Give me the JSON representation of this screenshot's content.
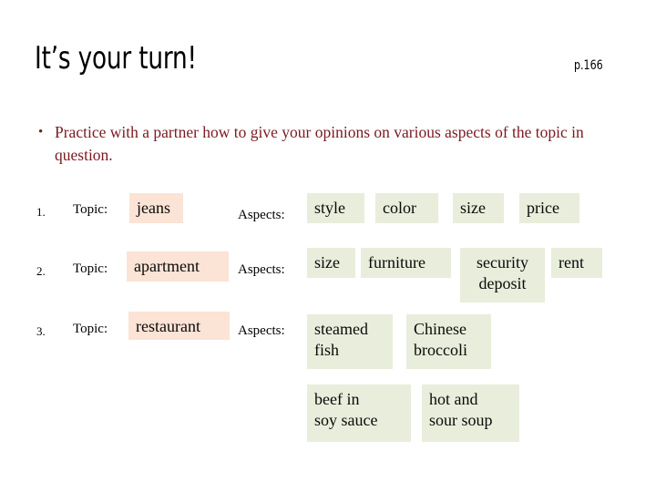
{
  "slide": {
    "title": "It’s your turn!",
    "page_ref": "p.166",
    "bullet": {
      "marker": "•",
      "text": "Practice with a partner how to give your opinions on various aspects of the topic in question."
    },
    "labels": {
      "topic": "Topic:",
      "aspects": "Aspects:"
    },
    "colors": {
      "title_text": "#000000",
      "bullet_text": "#7B1A20",
      "topic_chip_bg": "#FBE3D5",
      "aspect_chip_bg": "#E9EDDB",
      "background": "#FFFFFF"
    },
    "exercises": [
      {
        "number": "1.",
        "topic_label": "Topic:",
        "topic": "jeans",
        "aspects_label": "Aspects:",
        "aspects": [
          "style",
          "color",
          "size",
          "price"
        ]
      },
      {
        "number": "2.",
        "topic_label": "Topic:",
        "topic": "apartment",
        "aspects_label": "Aspects:",
        "aspects": [
          "size",
          "furniture",
          "security\ndeposit",
          "rent"
        ]
      },
      {
        "number": "3.",
        "topic_label": "Topic:",
        "topic": "restaurant",
        "aspects_label": "Aspects:",
        "aspects": [
          "steamed\nfish",
          "Chinese\nbroccoli",
          "beef in\nsoy sauce",
          "hot and\nsour soup"
        ]
      }
    ]
  }
}
